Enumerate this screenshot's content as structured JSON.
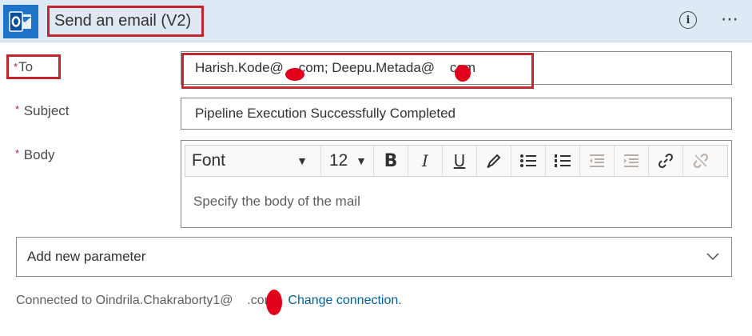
{
  "header": {
    "title": "Send an email (V2)",
    "info_icon": "info-icon",
    "more_icon": "more-options-icon",
    "app_icon": "outlook-icon",
    "app_icon_color": "#1e74c8",
    "background": "#ddeaf6"
  },
  "fields": {
    "to": {
      "label": "To",
      "required_mark": "*",
      "value": "Harish.Kode@    com; Deepu.Metada@    com"
    },
    "subject": {
      "label": "Subject",
      "required_mark": "*",
      "value": "Pipeline Execution Successfully Completed"
    },
    "body": {
      "label": "Body",
      "required_mark": "*",
      "placeholder": "Specify the body of the mail",
      "toolbar": {
        "font": "Font",
        "font_size": "12",
        "buttons": [
          "bold-icon",
          "italic-icon",
          "underline-icon",
          "highlight-pen-icon",
          "bullet-list-icon",
          "numbered-list-icon",
          "decrease-indent-icon",
          "increase-indent-icon",
          "link-icon",
          "unlink-icon"
        ]
      }
    }
  },
  "add_parameter": {
    "label": "Add new parameter"
  },
  "footer": {
    "connected_text": "Connected to Oindrila.Chakraborty1@    .com.",
    "change_link": "Change connection."
  },
  "colors": {
    "annotation_red": "#c4262e",
    "link": "#0062a3",
    "required": "#a4262c"
  }
}
